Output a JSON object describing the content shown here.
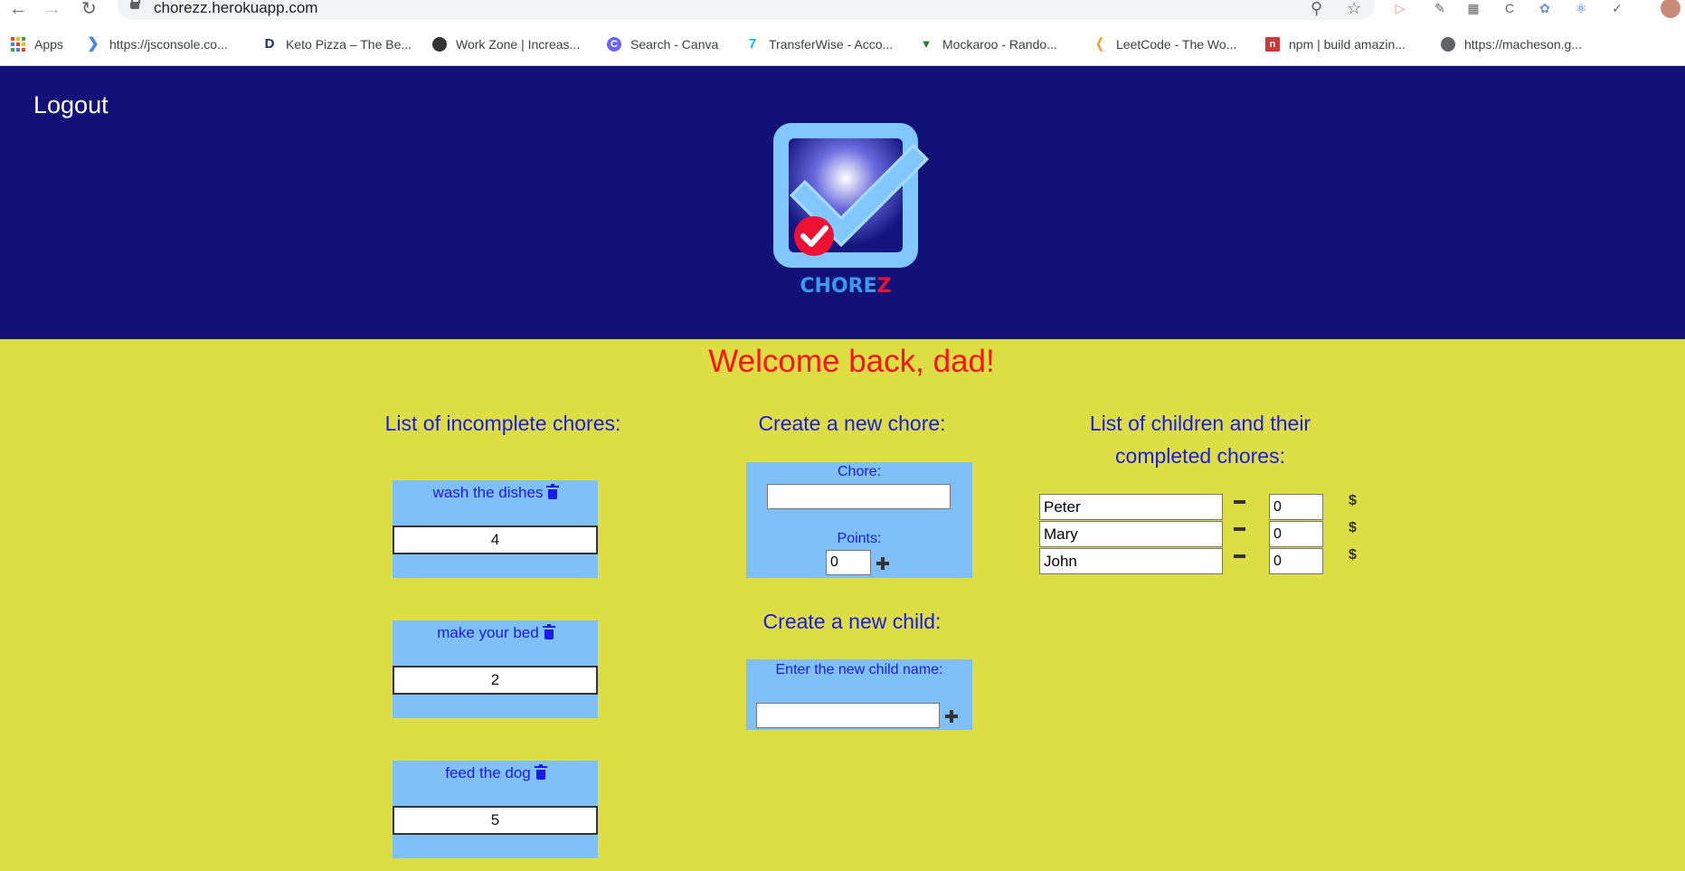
{
  "browser": {
    "url": "chorezz.herokuapp.com",
    "bookmarks": [
      {
        "label": "Apps",
        "icon": "apps-grid-icon"
      },
      {
        "label": "https://jsconsole.co...",
        "icon": "chevron-icon"
      },
      {
        "label": "Keto Pizza – The Be...",
        "icon": "d-logo-icon"
      },
      {
        "label": "Work Zone | Increas...",
        "icon": "workzone-icon"
      },
      {
        "label": "Search - Canva",
        "icon": "canva-icon"
      },
      {
        "label": "TransferWise - Acco...",
        "icon": "transferwise-icon"
      },
      {
        "label": "Mockaroo - Rando...",
        "icon": "mockaroo-icon"
      },
      {
        "label": "LeetCode - The Wo...",
        "icon": "leetcode-icon"
      },
      {
        "label": "npm | build amazin...",
        "icon": "npm-icon"
      },
      {
        "label": "https://macheson.g...",
        "icon": "globe-icon"
      }
    ]
  },
  "header": {
    "logout_label": "Logout",
    "logo_text_main": "CHORE",
    "logo_text_accent": "Z",
    "colors": {
      "background": "#111177",
      "logo_blue": "#80c8ff",
      "logo_red": "#ee1133"
    }
  },
  "main": {
    "welcome": "Welcome back, dad!",
    "incomplete": {
      "title": "List of incomplete chores:",
      "chores": [
        {
          "name": "wash the dishes",
          "points": "4"
        },
        {
          "name": "make your bed",
          "points": "2"
        },
        {
          "name": "feed the dog",
          "points": "5"
        }
      ]
    },
    "new_chore": {
      "title": "Create a new chore:",
      "chore_label": "Chore:",
      "chore_value": "",
      "points_label": "Points:",
      "points_value": "0"
    },
    "new_child": {
      "title": "Create a new child:",
      "name_label": "Enter the new child name:",
      "name_value": ""
    },
    "children": {
      "title_line1": "List of children and their",
      "title_line2": "completed chores:",
      "list": [
        {
          "name": "Peter",
          "count": "0"
        },
        {
          "name": "Mary",
          "count": "0"
        },
        {
          "name": "John",
          "count": "0"
        }
      ]
    },
    "colors": {
      "background": "#dddd44",
      "card": "#80c0f8",
      "heading": "#1a1aee",
      "welcome": "#ff1111"
    }
  }
}
